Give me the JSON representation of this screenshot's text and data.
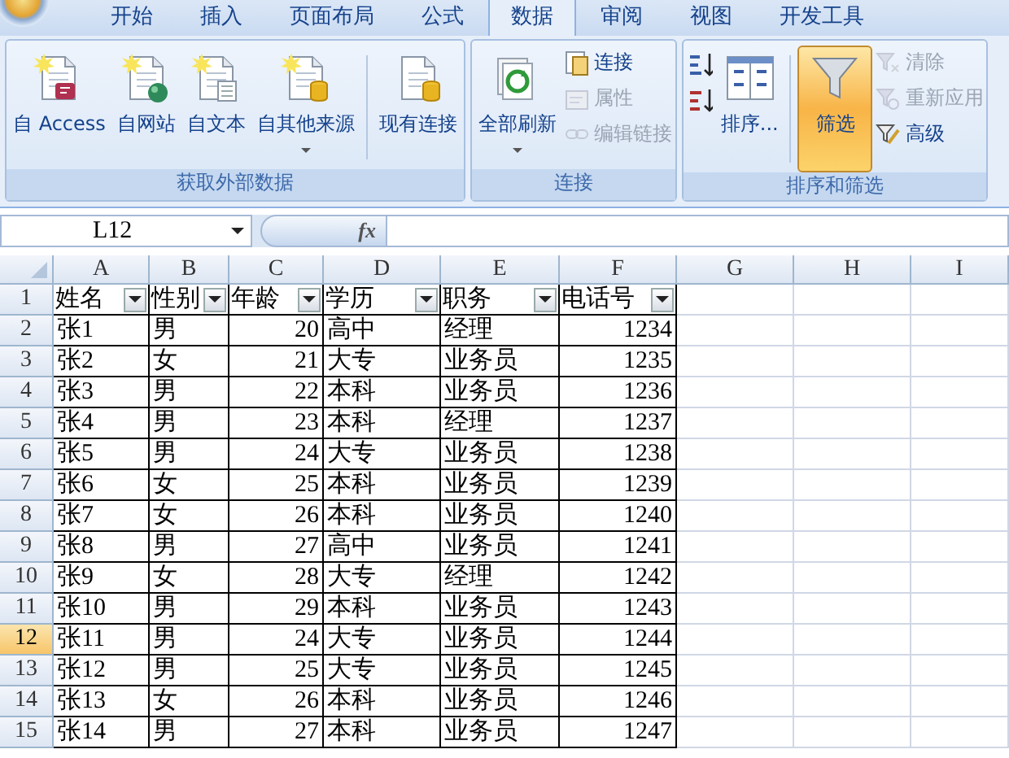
{
  "tabs": [
    {
      "label": "开始",
      "selected": false
    },
    {
      "label": "插入",
      "selected": false
    },
    {
      "label": "页面布局",
      "selected": false
    },
    {
      "label": "公式",
      "selected": false
    },
    {
      "label": "数据",
      "selected": true
    },
    {
      "label": "审阅",
      "selected": false
    },
    {
      "label": "视图",
      "selected": false
    },
    {
      "label": "开发工具",
      "selected": false
    }
  ],
  "ribbon": {
    "groups": [
      {
        "label": "获取外部数据",
        "items": [
          {
            "kind": "large",
            "label": "自 Access",
            "dropdown": false
          },
          {
            "kind": "large",
            "label": "自网站",
            "dropdown": false
          },
          {
            "kind": "large",
            "label": "自文本",
            "dropdown": false
          },
          {
            "kind": "large",
            "label": "自其他来源",
            "dropdown": true
          },
          {
            "kind": "separator"
          },
          {
            "kind": "large",
            "label": "现有连接",
            "dropdown": false
          }
        ]
      },
      {
        "label": "连接",
        "items": [
          {
            "kind": "large",
            "label": "全部刷新",
            "dropdown": true
          },
          {
            "kind": "stack",
            "items": [
              {
                "kind": "small",
                "label": "连接",
                "disabled": false
              },
              {
                "kind": "small",
                "label": "属性",
                "disabled": true
              },
              {
                "kind": "small",
                "label": "编辑链接",
                "disabled": true
              }
            ]
          }
        ]
      },
      {
        "label": "排序和筛选",
        "items": [
          {
            "kind": "stack",
            "items": [
              {
                "kind": "small",
                "disabled": false
              },
              {
                "kind": "small",
                "disabled": false
              }
            ]
          },
          {
            "kind": "large",
            "label": "排序...",
            "dropdown": false
          },
          {
            "kind": "separator"
          },
          {
            "kind": "large",
            "label": "筛选",
            "dropdown": false,
            "pressed": true
          },
          {
            "kind": "stack",
            "items": [
              {
                "kind": "small",
                "label": "清除",
                "disabled": true
              },
              {
                "kind": "small",
                "label": "重新应用",
                "disabled": true
              },
              {
                "kind": "small",
                "label": "高级",
                "disabled": false
              }
            ]
          }
        ]
      }
    ]
  },
  "formula_bar": {
    "name_box": "L12",
    "function_button": "fx"
  },
  "sheet": {
    "columns": [
      {
        "letter": "A",
        "kind": "text"
      },
      {
        "letter": "B",
        "kind": "text"
      },
      {
        "letter": "C",
        "kind": "number"
      },
      {
        "letter": "D",
        "kind": "text"
      },
      {
        "letter": "E",
        "kind": "text"
      },
      {
        "letter": "F",
        "kind": "number"
      },
      {
        "letter": "G"
      },
      {
        "letter": "H"
      },
      {
        "letter": "I"
      }
    ],
    "rows": [
      {
        "number": "1",
        "selected": false,
        "kind": "header",
        "cells": [
          "姓名",
          "性别",
          "年龄",
          "学历",
          "职务",
          "电话号"
        ]
      },
      {
        "number": "2",
        "selected": false,
        "cells": [
          "张1",
          "男",
          "20",
          "高中",
          "经理",
          "1234"
        ]
      },
      {
        "number": "3",
        "selected": false,
        "cells": [
          "张2",
          "女",
          "21",
          "大专",
          "业务员",
          "1235"
        ]
      },
      {
        "number": "4",
        "selected": false,
        "cells": [
          "张3",
          "男",
          "22",
          "本科",
          "业务员",
          "1236"
        ]
      },
      {
        "number": "5",
        "selected": false,
        "cells": [
          "张4",
          "男",
          "23",
          "本科",
          "经理",
          "1237"
        ]
      },
      {
        "number": "6",
        "selected": false,
        "cells": [
          "张5",
          "男",
          "24",
          "大专",
          "业务员",
          "1238"
        ]
      },
      {
        "number": "7",
        "selected": false,
        "cells": [
          "张6",
          "女",
          "25",
          "本科",
          "业务员",
          "1239"
        ]
      },
      {
        "number": "8",
        "selected": false,
        "cells": [
          "张7",
          "女",
          "26",
          "本科",
          "业务员",
          "1240"
        ]
      },
      {
        "number": "9",
        "selected": false,
        "cells": [
          "张8",
          "男",
          "27",
          "高中",
          "业务员",
          "1241"
        ]
      },
      {
        "number": "10",
        "selected": false,
        "cells": [
          "张9",
          "女",
          "28",
          "大专",
          "经理",
          "1242"
        ]
      },
      {
        "number": "11",
        "selected": false,
        "cells": [
          "张10",
          "男",
          "29",
          "本科",
          "业务员",
          "1243"
        ]
      },
      {
        "number": "12",
        "selected": true,
        "cells": [
          "张11",
          "男",
          "24",
          "大专",
          "业务员",
          "1244"
        ]
      },
      {
        "number": "13",
        "selected": false,
        "cells": [
          "张12",
          "男",
          "25",
          "大专",
          "业务员",
          "1245"
        ]
      },
      {
        "number": "14",
        "selected": false,
        "cells": [
          "张13",
          "女",
          "26",
          "本科",
          "业务员",
          "1246"
        ]
      },
      {
        "number": "15",
        "selected": false,
        "cells": [
          "张14",
          "男",
          "27",
          "本科",
          "业务员",
          "1247"
        ]
      }
    ]
  }
}
